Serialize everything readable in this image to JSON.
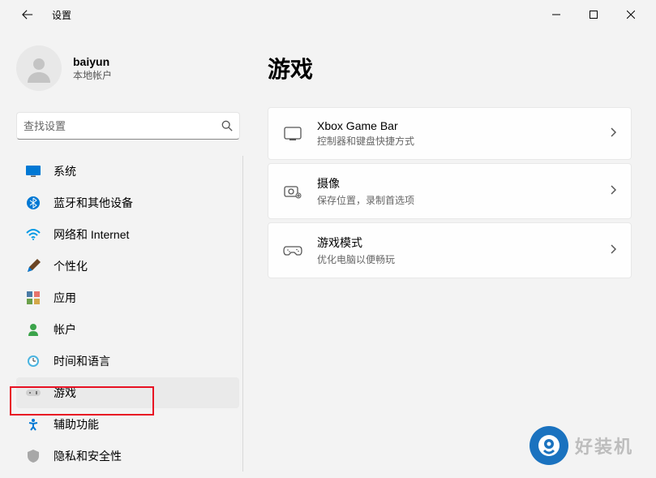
{
  "titlebar": {
    "app_title": "设置"
  },
  "profile": {
    "name": "baiyun",
    "subtitle": "本地帐户"
  },
  "search": {
    "placeholder": "查找设置"
  },
  "sidebar": {
    "items": [
      {
        "label": "系统",
        "icon": "system"
      },
      {
        "label": "蓝牙和其他设备",
        "icon": "bluetooth"
      },
      {
        "label": "网络和 Internet",
        "icon": "network"
      },
      {
        "label": "个性化",
        "icon": "personalization"
      },
      {
        "label": "应用",
        "icon": "apps"
      },
      {
        "label": "帐户",
        "icon": "account"
      },
      {
        "label": "时间和语言",
        "icon": "time"
      },
      {
        "label": "游戏",
        "icon": "gaming"
      },
      {
        "label": "辅助功能",
        "icon": "accessibility"
      },
      {
        "label": "隐私和安全性",
        "icon": "privacy"
      }
    ],
    "selected_index": 7
  },
  "page": {
    "title": "游戏"
  },
  "cards": [
    {
      "title": "Xbox Game Bar",
      "subtitle": "控制器和键盘快捷方式",
      "icon": "xbox"
    },
    {
      "title": "摄像",
      "subtitle": "保存位置，录制首选项",
      "icon": "capture"
    },
    {
      "title": "游戏模式",
      "subtitle": "优化电脑以便畅玩",
      "icon": "gamemode"
    }
  ],
  "watermark": {
    "text": "好装机"
  }
}
